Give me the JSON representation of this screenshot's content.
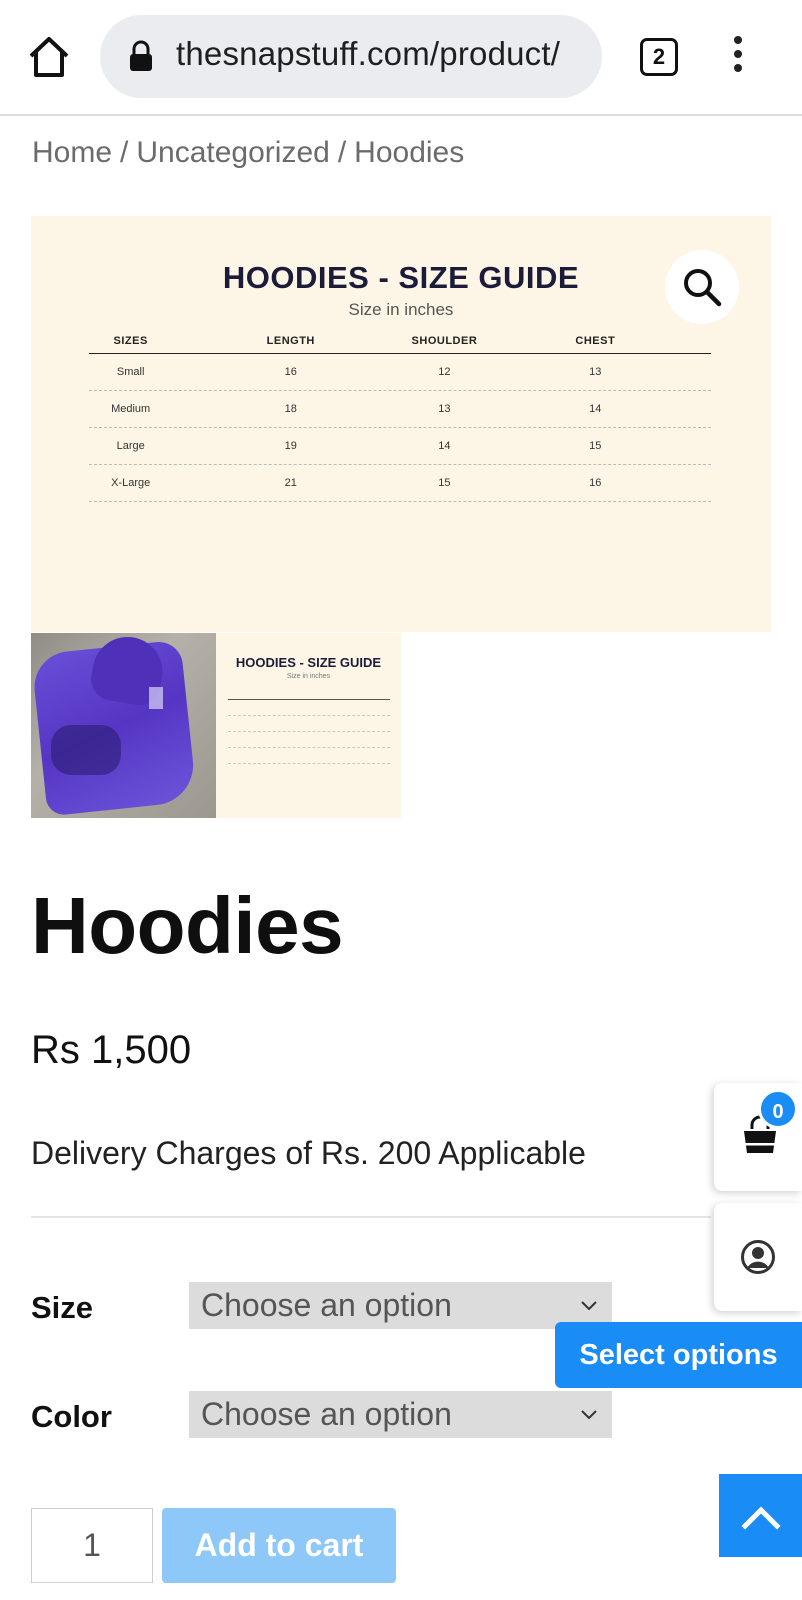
{
  "browser": {
    "url": "thesnapstuff.com/product/",
    "tab_count": "2"
  },
  "breadcrumb": {
    "items": [
      "Home",
      "Uncategorized",
      "Hoodies"
    ],
    "separator": "/"
  },
  "size_guide": {
    "title": "HOODIES - SIZE GUIDE",
    "subtitle": "Size in inches",
    "columns": [
      "SIZES",
      "LENGTH",
      "SHOULDER",
      "CHEST"
    ],
    "rows": [
      [
        "Small",
        "16",
        "12",
        "13"
      ],
      [
        "Medium",
        "18",
        "13",
        "14"
      ],
      [
        "Large",
        "19",
        "14",
        "15"
      ],
      [
        "X-Large",
        "21",
        "15",
        "16"
      ]
    ]
  },
  "thumbnails": {
    "thumb2_title": "HOODIES - SIZE GUIDE",
    "thumb2_subtitle": "Size in inches"
  },
  "product": {
    "title": "Hoodies",
    "price": "Rs 1,500",
    "delivery_note": "Delivery Charges of Rs. 200 Applicable"
  },
  "options": {
    "size_label": "Size",
    "size_value": "Choose an option",
    "color_label": "Color",
    "color_value": "Choose an option"
  },
  "cart": {
    "quantity": "1",
    "add_to_cart_label": "Add to cart",
    "badge_count": "0"
  },
  "floating": {
    "select_options_label": "Select options"
  },
  "colors": {
    "accent": "#1a8cf5",
    "add_to_cart_disabled": "#8ec8f9",
    "guide_background": "#fdf6e6",
    "select_background": "#dcdcdc"
  },
  "icons": [
    "home-icon",
    "lock-icon",
    "more-vert-icon",
    "search-icon",
    "shopping-bag-icon",
    "account-icon",
    "chevron-down-icon",
    "chevron-up-icon"
  ]
}
